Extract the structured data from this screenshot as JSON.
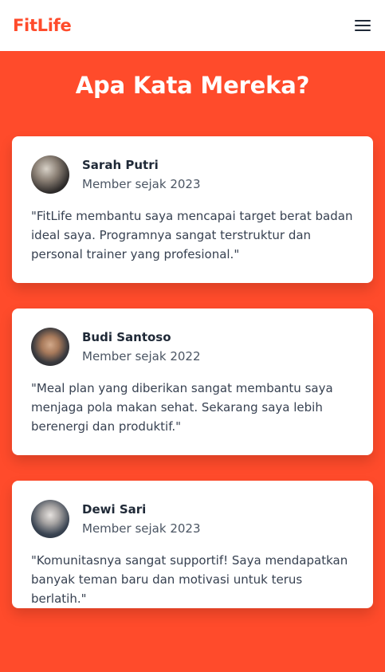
{
  "navbar": {
    "logo": "FitLife",
    "menu_icon": "hamburger-menu-icon"
  },
  "testimonials": {
    "title": "Apa Kata Mereka?",
    "items": [
      {
        "name": "Sarah Putri",
        "since": "Member sejak 2023",
        "quote": "\"FitLife membantu saya mencapai target berat badan ideal saya. Programnya sangat terstruktur dan personal trainer yang profesional.\""
      },
      {
        "name": "Budi Santoso",
        "since": "Member sejak 2022",
        "quote": "\"Meal plan yang diberikan sangat membantu saya menjaga pola makan sehat. Sekarang saya lebih berenergi dan produktif.\""
      },
      {
        "name": "Dewi Sari",
        "since": "Member sejak 2023",
        "quote": "\"Komunitasnya sangat supportif! Saya mendapatkan banyak teman baru dan motivasi untuk terus berlatih.\""
      }
    ]
  },
  "colors": {
    "brand": "#ff4b2b",
    "card": "#ffffff",
    "text_dark": "#1f2937",
    "text_muted": "#4b5563"
  }
}
